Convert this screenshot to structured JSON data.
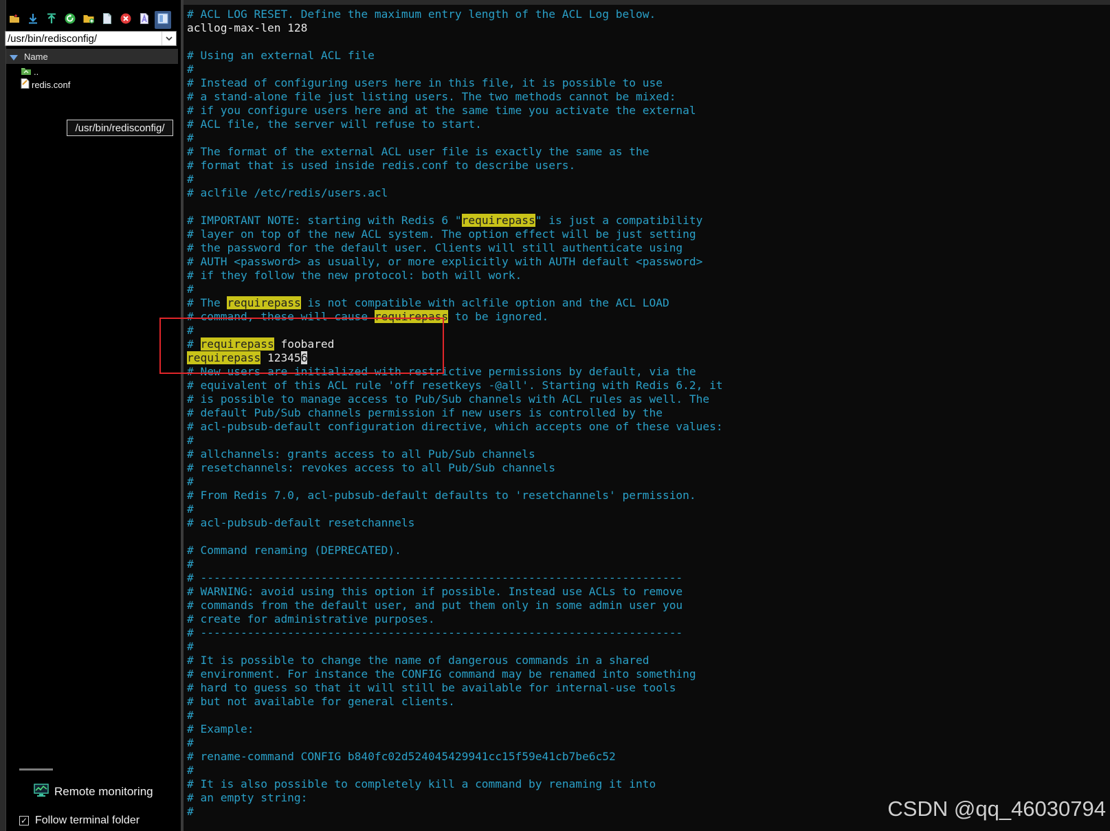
{
  "sidebar": {
    "toolbar": [
      {
        "icon": "new-folder-icon",
        "label": "",
        "color": "#e3b23c"
      },
      {
        "icon": "download-icon",
        "label": "",
        "color": "#3b9bd9"
      },
      {
        "icon": "upload-icon",
        "label": "",
        "color": "#3ac09a"
      },
      {
        "icon": "refresh-icon",
        "label": "",
        "color": "#35b04a"
      },
      {
        "icon": "folder-add-icon",
        "label": "",
        "color": "#e8b62e"
      },
      {
        "icon": "new-file-icon",
        "label": "",
        "color": "#dfe7f3"
      },
      {
        "icon": "delete-icon",
        "label": "",
        "color": "#e23a3a"
      },
      {
        "icon": "rename-icon",
        "label": "",
        "color": "#8a7fe0"
      },
      {
        "icon": "view-toggle-icon",
        "label": "",
        "color": "#7aa8e0"
      }
    ],
    "path_value": "/usr/bin/redisconfig/",
    "column_name": "Name",
    "files": [
      {
        "name": "..",
        "icon": "parent-folder-icon"
      },
      {
        "name": "redis.conf",
        "icon": "file-icon"
      }
    ],
    "tooltip": "/usr/bin/redisconfig/",
    "remote_monitoring": "Remote monitoring",
    "follow_terminal_folder": "Follow terminal folder",
    "follow_checked": true
  },
  "editor": {
    "lines": [
      {
        "type": "comment",
        "segments": [
          {
            "t": "# ACL LOG RESET. Define the maximum entry length of the ACL Log below."
          }
        ]
      },
      {
        "type": "code",
        "segments": [
          {
            "t": "acllog-max-len 128"
          }
        ]
      },
      {
        "type": "blank",
        "segments": [
          {
            "t": ""
          }
        ]
      },
      {
        "type": "comment",
        "segments": [
          {
            "t": "# Using an external ACL file"
          }
        ]
      },
      {
        "type": "comment",
        "segments": [
          {
            "t": "#"
          }
        ]
      },
      {
        "type": "comment",
        "segments": [
          {
            "t": "# Instead of configuring users here in this file, it is possible to use"
          }
        ]
      },
      {
        "type": "comment",
        "segments": [
          {
            "t": "# a stand-alone file just listing users. The two methods cannot be mixed:"
          }
        ]
      },
      {
        "type": "comment",
        "segments": [
          {
            "t": "# if you configure users here and at the same time you activate the external"
          }
        ]
      },
      {
        "type": "comment",
        "segments": [
          {
            "t": "# ACL file, the server will refuse to start."
          }
        ]
      },
      {
        "type": "comment",
        "segments": [
          {
            "t": "#"
          }
        ]
      },
      {
        "type": "comment",
        "segments": [
          {
            "t": "# The format of the external ACL user file is exactly the same as the"
          }
        ]
      },
      {
        "type": "comment",
        "segments": [
          {
            "t": "# format that is used inside redis.conf to describe users."
          }
        ]
      },
      {
        "type": "comment",
        "segments": [
          {
            "t": "#"
          }
        ]
      },
      {
        "type": "comment",
        "segments": [
          {
            "t": "# aclfile /etc/redis/users.acl"
          }
        ]
      },
      {
        "type": "blank",
        "segments": [
          {
            "t": ""
          }
        ]
      },
      {
        "type": "comment",
        "segments": [
          {
            "t": "# IMPORTANT NOTE: starting with Redis 6 \""
          },
          {
            "t": "requirepass",
            "hl": true
          },
          {
            "t": "\" is just a compatibility"
          }
        ]
      },
      {
        "type": "comment",
        "segments": [
          {
            "t": "# layer on top of the new ACL system. The option effect will be just setting"
          }
        ]
      },
      {
        "type": "comment",
        "segments": [
          {
            "t": "# the password for the default user. Clients will still authenticate using"
          }
        ]
      },
      {
        "type": "comment",
        "segments": [
          {
            "t": "# AUTH <password> as usually, or more explicitly with AUTH default <password>"
          }
        ]
      },
      {
        "type": "comment",
        "segments": [
          {
            "t": "# if they follow the new protocol: both will work."
          }
        ]
      },
      {
        "type": "comment",
        "segments": [
          {
            "t": "#"
          }
        ]
      },
      {
        "type": "comment",
        "segments": [
          {
            "t": "# The "
          },
          {
            "t": "requirepass",
            "hl": true
          },
          {
            "t": " is not compatible with aclfile option and the ACL LOAD"
          }
        ]
      },
      {
        "type": "comment",
        "segments": [
          {
            "t": "# command, these will cause "
          },
          {
            "t": "requirepass",
            "hl": true
          },
          {
            "t": " to be ignored."
          }
        ]
      },
      {
        "type": "comment",
        "segments": [
          {
            "t": "#"
          }
        ]
      },
      {
        "type": "comment",
        "segments": [
          {
            "t": "# "
          },
          {
            "t": "requirepass",
            "hl": true
          },
          {
            "t": " foobared",
            "plain": true
          }
        ]
      },
      {
        "type": "code",
        "segments": [
          {
            "t": "requirepass",
            "hl": true
          },
          {
            "t": " 12345"
          },
          {
            "t": "6",
            "cursor": true
          }
        ]
      },
      {
        "type": "comment",
        "segments": [
          {
            "t": "# New users are initialized with restrictive permissions by default, via the"
          }
        ]
      },
      {
        "type": "comment",
        "segments": [
          {
            "t": "# equivalent of this ACL rule 'off resetkeys -@all'. Starting with Redis 6.2, it"
          }
        ]
      },
      {
        "type": "comment",
        "segments": [
          {
            "t": "# is possible to manage access to Pub/Sub channels with ACL rules as well. The"
          }
        ]
      },
      {
        "type": "comment",
        "segments": [
          {
            "t": "# default Pub/Sub channels permission if new users is controlled by the"
          }
        ]
      },
      {
        "type": "comment",
        "segments": [
          {
            "t": "# acl-pubsub-default configuration directive, which accepts one of these values:"
          }
        ]
      },
      {
        "type": "comment",
        "segments": [
          {
            "t": "#"
          }
        ]
      },
      {
        "type": "comment",
        "segments": [
          {
            "t": "# allchannels: grants access to all Pub/Sub channels"
          }
        ]
      },
      {
        "type": "comment",
        "segments": [
          {
            "t": "# resetchannels: revokes access to all Pub/Sub channels"
          }
        ]
      },
      {
        "type": "comment",
        "segments": [
          {
            "t": "#"
          }
        ]
      },
      {
        "type": "comment",
        "segments": [
          {
            "t": "# From Redis 7.0, acl-pubsub-default defaults to 'resetchannels' permission."
          }
        ]
      },
      {
        "type": "comment",
        "segments": [
          {
            "t": "#"
          }
        ]
      },
      {
        "type": "comment",
        "segments": [
          {
            "t": "# acl-pubsub-default resetchannels"
          }
        ]
      },
      {
        "type": "blank",
        "segments": [
          {
            "t": ""
          }
        ]
      },
      {
        "type": "comment",
        "segments": [
          {
            "t": "# Command renaming (DEPRECATED)."
          }
        ]
      },
      {
        "type": "comment",
        "segments": [
          {
            "t": "#"
          }
        ]
      },
      {
        "type": "comment",
        "segments": [
          {
            "t": "# ------------------------------------------------------------------------"
          }
        ]
      },
      {
        "type": "comment",
        "segments": [
          {
            "t": "# WARNING: avoid using this option if possible. Instead use ACLs to remove"
          }
        ]
      },
      {
        "type": "comment",
        "segments": [
          {
            "t": "# commands from the default user, and put them only in some admin user you"
          }
        ]
      },
      {
        "type": "comment",
        "segments": [
          {
            "t": "# create for administrative purposes."
          }
        ]
      },
      {
        "type": "comment",
        "segments": [
          {
            "t": "# ------------------------------------------------------------------------"
          }
        ]
      },
      {
        "type": "comment",
        "segments": [
          {
            "t": "#"
          }
        ]
      },
      {
        "type": "comment",
        "segments": [
          {
            "t": "# It is possible to change the name of dangerous commands in a shared"
          }
        ]
      },
      {
        "type": "comment",
        "segments": [
          {
            "t": "# environment. For instance the CONFIG command may be renamed into something"
          }
        ]
      },
      {
        "type": "comment",
        "segments": [
          {
            "t": "# hard to guess so that it will still be available for internal-use tools"
          }
        ]
      },
      {
        "type": "comment",
        "segments": [
          {
            "t": "# but not available for general clients."
          }
        ]
      },
      {
        "type": "comment",
        "segments": [
          {
            "t": "#"
          }
        ]
      },
      {
        "type": "comment",
        "segments": [
          {
            "t": "# Example:"
          }
        ]
      },
      {
        "type": "comment",
        "segments": [
          {
            "t": "#"
          }
        ]
      },
      {
        "type": "comment",
        "segments": [
          {
            "t": "# rename-command CONFIG b840fc02d524045429941cc15f59e41cb7be6c52"
          }
        ]
      },
      {
        "type": "comment",
        "segments": [
          {
            "t": "#"
          }
        ]
      },
      {
        "type": "comment",
        "segments": [
          {
            "t": "# It is also possible to completely kill a command by renaming it into"
          }
        ]
      },
      {
        "type": "comment",
        "segments": [
          {
            "t": "# an empty string:"
          }
        ]
      },
      {
        "type": "comment",
        "segments": [
          {
            "t": "#"
          }
        ]
      }
    ]
  },
  "watermark": "CSDN @qq_46030794",
  "colors": {
    "comment": "#2aa0c8",
    "code": "#e8e8e8",
    "highlight": "#c9c319",
    "annotation": "#e0262a"
  }
}
